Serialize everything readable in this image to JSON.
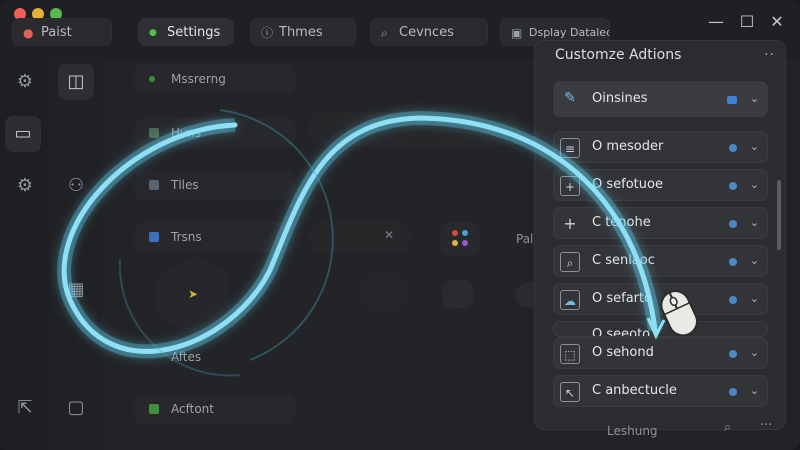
{
  "titlebar": {
    "tabs": [
      {
        "label": "Paist",
        "icon": "app-icon"
      },
      {
        "label": "Settings",
        "icon": "green-dot-icon"
      },
      {
        "label": "Thmes",
        "icon": "info-icon"
      },
      {
        "label": "Cevnces",
        "icon": "search-icon"
      },
      {
        "label": "Dsplay Dataled",
        "icon": "document-icon"
      }
    ],
    "window_controls": {
      "minimize": "—",
      "maximize": "☐",
      "close": "✕"
    }
  },
  "main": {
    "rows": [
      {
        "label": "Mssrerng"
      },
      {
        "label": "Hvns"
      },
      {
        "label": "Tlles"
      },
      {
        "label": "Trsns"
      },
      {
        "label": "Aftes"
      },
      {
        "label": "Acftont"
      }
    ],
    "other_label": "Pale"
  },
  "panel": {
    "title": "Customze Adtions",
    "more": "··",
    "items": [
      {
        "label": "Oinsines",
        "icon": "plug-icon"
      },
      {
        "label": "O mesoder",
        "icon": "list-icon"
      },
      {
        "label": "O sefotuoe",
        "icon": "plus-box-icon"
      },
      {
        "label": "C tenohe",
        "icon": "plus-icon"
      },
      {
        "label": "C senlaoc",
        "icon": "search-box-icon"
      },
      {
        "label": "O sefarto",
        "icon": "cloud-icon"
      },
      {
        "label": "O sehond",
        "icon": "frame-icon"
      },
      {
        "label": "C anbectucle",
        "icon": "cursor-box-icon"
      }
    ],
    "partial_item": "O seeoto"
  },
  "footer": {
    "text": "Leshung"
  },
  "colors": {
    "accent": "#3f7fd6",
    "swirl": "#6fd3f0",
    "background": "#222326"
  }
}
